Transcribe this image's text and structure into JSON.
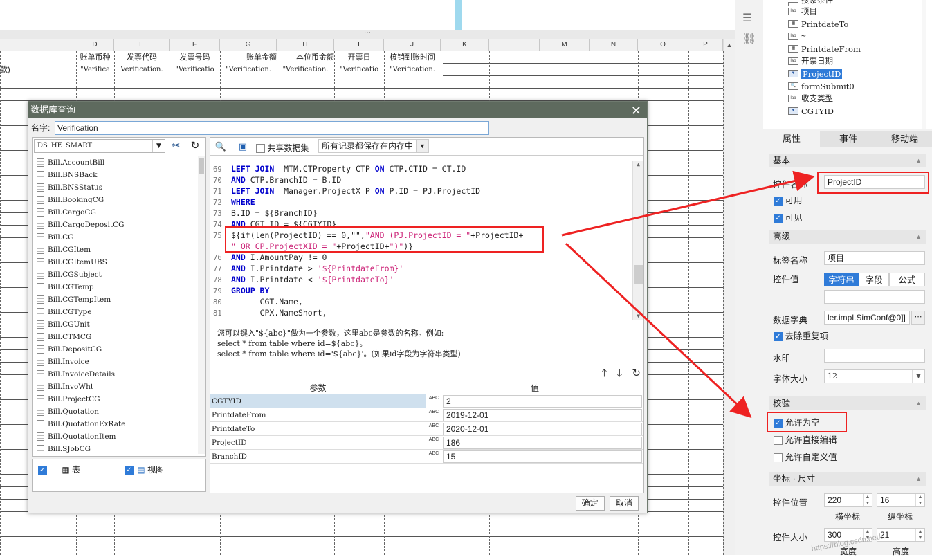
{
  "sheet": {
    "columns": [
      "D",
      "E",
      "F",
      "G",
      "H",
      "I",
      "J",
      "K",
      "L",
      "M",
      "N",
      "O",
      "P"
    ],
    "headers": [
      "账单币种",
      "发票代码",
      "发票号码",
      "账单金额",
      "本位币金额",
      "开票日",
      "核销到账时间"
    ],
    "values": [
      "\"Verifica",
      "Verification.",
      "\"Verificatio",
      "\"Verification.",
      "\"Verification.",
      "\"Verificatio",
      "\"Verification."
    ],
    "left_cell": "款)",
    "grip": "⋯"
  },
  "dialog": {
    "title": "数据库查询",
    "name_label": "名字:",
    "name_value": "Verification",
    "datasource": "DS_HE_SMART",
    "tables": [
      "Bill.AccountBill",
      "Bill.BNSBack",
      "Bill.BNSStatus",
      "Bill.BookingCG",
      "Bill.CargoCG",
      "Bill.CargoDepositCG",
      "Bill.CG",
      "Bill.CGItem",
      "Bill.CGItemUBS",
      "Bill.CGSubject",
      "Bill.CGTemp",
      "Bill.CGTempItem",
      "Bill.CGType",
      "Bill.CGUnit",
      "Bill.CTMCG",
      "Bill.DepositCG",
      "Bill.Invoice",
      "Bill.InvoiceDetails",
      "Bill.InvoWht",
      "Bill.ProjectCG",
      "Bill.Quotation",
      "Bill.QuotationExRate",
      "Bill.QuotationItem",
      "Bill.SJobCG"
    ],
    "filter_table": "表",
    "filter_view": "视图",
    "shared_dataset": "共享数据集",
    "memory_mode": "所有记录都保存在内存中",
    "code_lines": [
      {
        "n": "69",
        "segs": [
          [
            "kw",
            "LEFT JOIN"
          ],
          [
            "",
            "  MTM.CTProperty CTP "
          ],
          [
            "kw",
            "ON"
          ],
          [
            "",
            " CTP.CTID = CT.ID"
          ]
        ]
      },
      {
        "n": "70",
        "segs": [
          [
            "kw",
            "AND"
          ],
          [
            "",
            " CTP.BranchID = B.ID"
          ]
        ]
      },
      {
        "n": "71",
        "segs": [
          [
            "kw",
            "LEFT JOIN"
          ],
          [
            "",
            "  Manager.ProjectX P "
          ],
          [
            "kw",
            "ON"
          ],
          [
            "",
            " P.ID = PJ.ProjectID"
          ]
        ]
      },
      {
        "n": "72",
        "segs": [
          [
            "kw",
            "WHERE"
          ]
        ]
      },
      {
        "n": "73",
        "segs": [
          [
            "",
            "B.ID = ${BranchID}"
          ]
        ]
      },
      {
        "n": "74",
        "segs": [
          [
            "kw",
            "AND"
          ],
          [
            "",
            " CGT.ID = ${CGTYID}"
          ]
        ]
      },
      {
        "n": "75",
        "segs": [
          [
            "",
            "${if(len(ProjectID) == 0,\"\","
          ],
          [
            "st",
            "\"AND (PJ.ProjectID = \""
          ],
          [
            "",
            "+ProjectID+"
          ]
        ]
      },
      {
        "n": "",
        "segs": [
          [
            "st",
            "\" OR CP.ProjectXID = \""
          ],
          [
            "",
            "+ProjectID+"
          ],
          [
            "st",
            "\")\""
          ],
          [
            "",
            ")}"
          ]
        ]
      },
      {
        "n": "76",
        "segs": [
          [
            "kw",
            "AND"
          ],
          [
            "",
            " I.AmountPay != 0"
          ]
        ]
      },
      {
        "n": "77",
        "segs": [
          [
            "kw",
            "AND"
          ],
          [
            "",
            " I.Printdate > "
          ],
          [
            "st",
            "'${PrintdateFrom}'"
          ]
        ]
      },
      {
        "n": "78",
        "segs": [
          [
            "kw",
            "AND"
          ],
          [
            "",
            " I.Printdate < "
          ],
          [
            "st",
            "'${PrintdateTo}'"
          ]
        ]
      },
      {
        "n": "79",
        "segs": [
          [
            "kw",
            "GROUP BY"
          ]
        ]
      },
      {
        "n": "80",
        "segs": [
          [
            "",
            "      CGT.Name,"
          ]
        ]
      },
      {
        "n": "81",
        "segs": [
          [
            "",
            "      CPX.NameShort,"
          ]
        ]
      }
    ],
    "hint": [
      "您可以键入\"${abc}\"做为一个参数，这里abc是参数的名称。例如:",
      "select * from table where id=${abc}。",
      "select * from table where id='${abc}'。(如果id字段为字符串类型)"
    ],
    "param_header": "参数",
    "value_header": "值",
    "type_icon": "ABC",
    "params": [
      {
        "name": "CGTYID",
        "value": "2"
      },
      {
        "name": "PrintdateFrom",
        "value": "2019-12-01"
      },
      {
        "name": "PrintdateTo",
        "value": "2020-12-01"
      },
      {
        "name": "ProjectID",
        "value": "186"
      },
      {
        "name": "BranchID",
        "value": "15"
      }
    ],
    "ok": "确定",
    "cancel": "取消"
  },
  "panel": {
    "tree": [
      {
        "label": "搜索条件",
        "icon": "",
        "partial": true
      },
      {
        "label": "项目",
        "icon": "lab"
      },
      {
        "label": "PrintdateTo",
        "icon": "cal"
      },
      {
        "label": "~",
        "icon": "lab"
      },
      {
        "label": "PrintdateFrom",
        "icon": "cal"
      },
      {
        "label": "开票日期",
        "icon": "lab"
      },
      {
        "label": "ProjectID",
        "icon": "combo",
        "selected": true
      },
      {
        "label": "formSubmit0",
        "icon": "search"
      },
      {
        "label": "收支类型",
        "icon": "lab"
      },
      {
        "label": "CGTYID",
        "icon": "combo"
      }
    ],
    "tabs": [
      "属性",
      "事件",
      "移动端"
    ],
    "sections": {
      "basic": "基本",
      "advanced": "高级",
      "validate": "校验",
      "coords": "坐标 · 尺寸"
    },
    "widget_name_label": "控件名称",
    "widget_name": "ProjectID",
    "enabled": "可用",
    "visible": "可见",
    "tag_label": "标签名称",
    "tag_value": "项目",
    "control_value_label": "控件值",
    "value_modes": [
      "字符串",
      "字段",
      "公式"
    ],
    "dict_label": "数据字典",
    "dict_value": "ler.impl.SimConf@0]]",
    "dedupe": "去除重复项",
    "watermark_label": "水印",
    "font_size_label": "字体大小",
    "font_size": "12",
    "allow_empty": "允许为空",
    "allow_direct_edit": "允许直接编辑",
    "allow_custom": "允许自定义值",
    "position_label": "控件位置",
    "pos_x": "220",
    "pos_y": "16",
    "x_caption": "横坐标",
    "y_caption": "纵坐标",
    "size_label": "控件大小",
    "width": "300",
    "height": "21",
    "w_caption": "宽度",
    "h_caption": "高度",
    "watermark_text": "https://blog.csdn.net/..."
  },
  "colors": {
    "accent": "#2f7bd8",
    "annotation": "#e22222",
    "dialog_title": "#5e6a5e"
  }
}
